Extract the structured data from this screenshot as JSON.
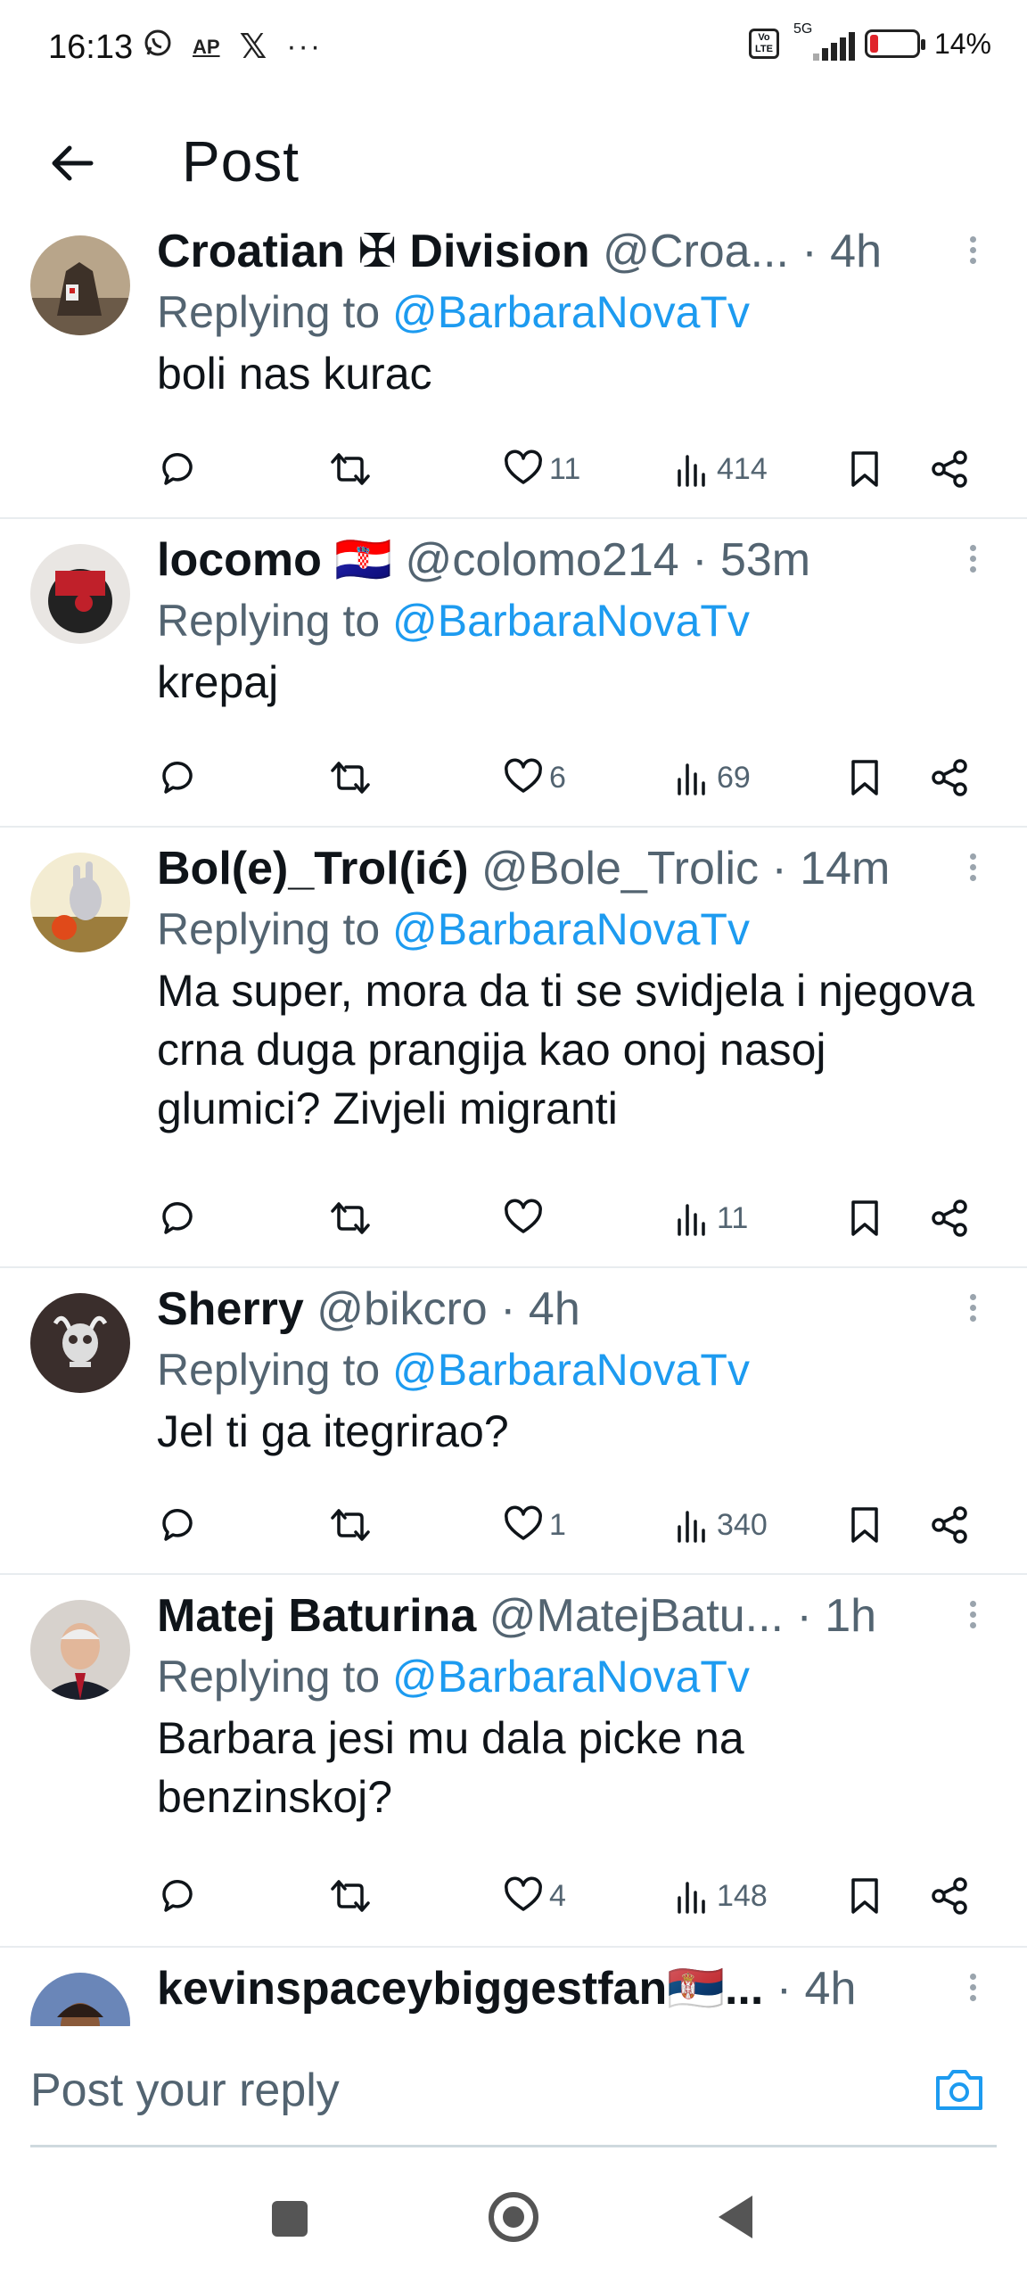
{
  "status_bar": {
    "time": "16:13",
    "notification_icons": [
      "whatsapp-icon",
      "ap-news-icon",
      "x-icon",
      "more-dots-icon"
    ],
    "ap_label": "AP",
    "x_label": "𝕏",
    "dots": "···",
    "volte": "Vo LTE",
    "network": "5G",
    "battery_level": 0.14,
    "battery_text": "14%"
  },
  "header": {
    "title": "Post",
    "back_icon": "arrow-left-icon"
  },
  "replies": [
    {
      "name": "Croatian ✠ Division",
      "handle": "@Croa...",
      "time": " · 4h",
      "replying_to_prefix": "Replying to ",
      "replying_to": "@BarbaraNovaTv",
      "text": "boli nas kurac",
      "likes": "11",
      "views": "414"
    },
    {
      "name": "locomo 🇭🇷",
      "handle": "@colomo214",
      "time": " · 53m",
      "replying_to_prefix": "Replying to ",
      "replying_to": "@BarbaraNovaTv",
      "text": "krepaj",
      "likes": "6",
      "views": "69"
    },
    {
      "name": "Bol(e)_Trol(ić)",
      "handle": "@Bole_Trolic",
      "time": " · 14m",
      "replying_to_prefix": "Replying to ",
      "replying_to": "@BarbaraNovaTv",
      "text": "Ma super, mora da ti se svidjela i njegova crna duga prangija kao onoj nasoj glumici? Zivjeli migranti",
      "likes": "",
      "views": "11"
    },
    {
      "name": "Sherry",
      "handle": "@bikcro",
      "time": " · 4h",
      "replying_to_prefix": "Replying to ",
      "replying_to": "@BarbaraNovaTv",
      "text": "Jel ti ga itegrirao?",
      "likes": "1",
      "views": "340"
    },
    {
      "name": "Matej Baturina",
      "handle": "@MatejBatu...",
      "time": " · 1h",
      "replying_to_prefix": "Replying to ",
      "replying_to": "@BarbaraNovaTv",
      "text": "Barbara jesi mu dala picke na benzinskoj?",
      "likes": "4",
      "views": "148"
    },
    {
      "name": "kevinspaceybiggestfan🇷🇸...",
      "handle": "",
      "time": " · 4h",
      "replying_to_prefix": "",
      "replying_to": "",
      "text": "",
      "likes": "",
      "views": ""
    }
  ],
  "composer": {
    "placeholder": "Post your reply",
    "camera_icon": "camera-icon"
  },
  "nav_bar": {
    "icons": [
      "recents-square-icon",
      "home-circle-icon",
      "back-triangle-icon"
    ]
  },
  "colors": {
    "accent": "#1d9bf0",
    "secondary_text": "#536471",
    "primary_text": "#0f1419",
    "battery_low": "#e0242b"
  }
}
